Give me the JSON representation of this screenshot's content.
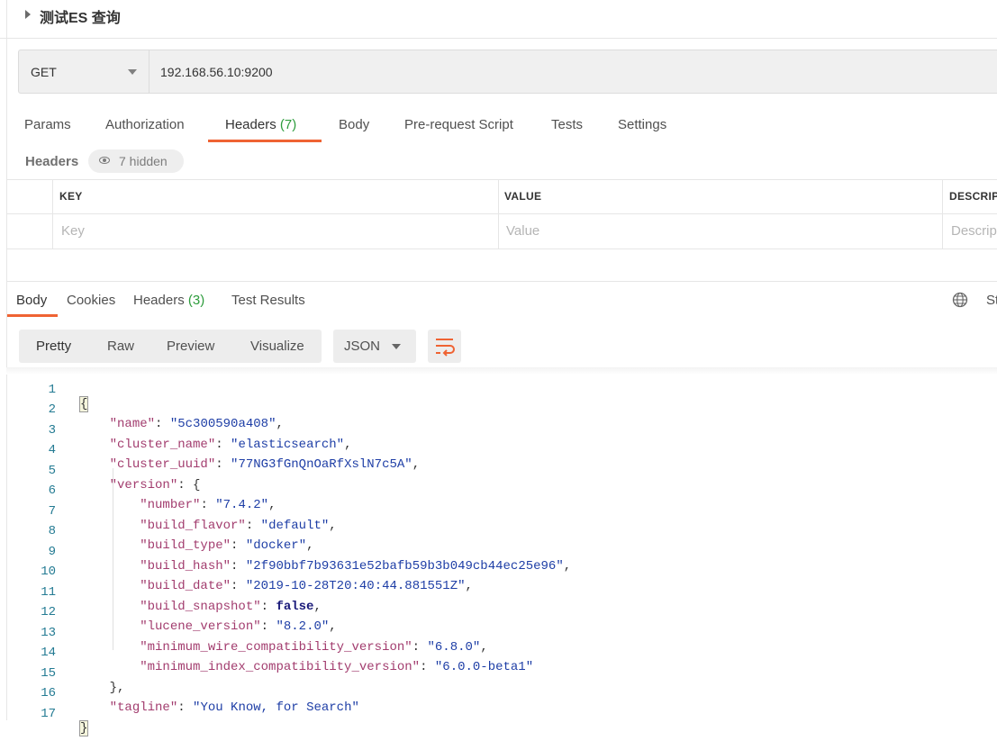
{
  "request": {
    "title": "测试ES 查询",
    "method": "GET",
    "url": "192.168.56.10:9200",
    "tabs": [
      {
        "label": "Params"
      },
      {
        "label": "Authorization"
      },
      {
        "label": "Headers",
        "count": "(7)"
      },
      {
        "label": "Body"
      },
      {
        "label": "Pre-request Script"
      },
      {
        "label": "Tests"
      },
      {
        "label": "Settings"
      }
    ],
    "headers_label": "Headers",
    "hidden_label": "7 hidden",
    "table": {
      "columns": [
        "KEY",
        "VALUE",
        "DESCRIPT"
      ],
      "placeholders": [
        "Key",
        "Value",
        "Descrip"
      ]
    }
  },
  "response": {
    "tabs": [
      {
        "label": "Body"
      },
      {
        "label": "Cookies"
      },
      {
        "label": "Headers",
        "count": "(3)"
      },
      {
        "label": "Test Results"
      }
    ],
    "status_partial": "St",
    "view_modes": [
      "Pretty",
      "Raw",
      "Preview",
      "Visualize"
    ],
    "format": "JSON",
    "line_numbers": [
      "1",
      "2",
      "3",
      "4",
      "5",
      "6",
      "7",
      "8",
      "9",
      "10",
      "11",
      "12",
      "13",
      "14",
      "15",
      "16",
      "17"
    ],
    "body": {
      "name": "5c300590a408",
      "cluster_name": "elasticsearch",
      "cluster_uuid": "77NG3fGnQnOaRfXslN7c5A",
      "version": {
        "number": "7.4.2",
        "build_flavor": "default",
        "build_type": "docker",
        "build_hash": "2f90bbf7b93631e52bafb59b3b049cb44ec25e96",
        "build_date": "2019-10-28T20:40:44.881551Z",
        "build_snapshot": "false",
        "lucene_version": "8.2.0",
        "minimum_wire_compatibility_version": "6.8.0",
        "minimum_index_compatibility_version": "6.0.0-beta1"
      },
      "tagline": "You Know, for Search"
    }
  },
  "colors": {
    "accent": "#ef6333",
    "count_green": "#2d9c3c",
    "json_key": "#a23c6e",
    "json_string": "#1e3ea6",
    "line_number": "#247b93"
  },
  "icons": {
    "collapse": "caret-right-icon",
    "method_dropdown": "chevron-down-icon",
    "hidden_headers": "eye-icon",
    "network": "globe-icon",
    "format_dropdown": "chevron-down-icon",
    "wrap": "wrap-lines-icon"
  }
}
